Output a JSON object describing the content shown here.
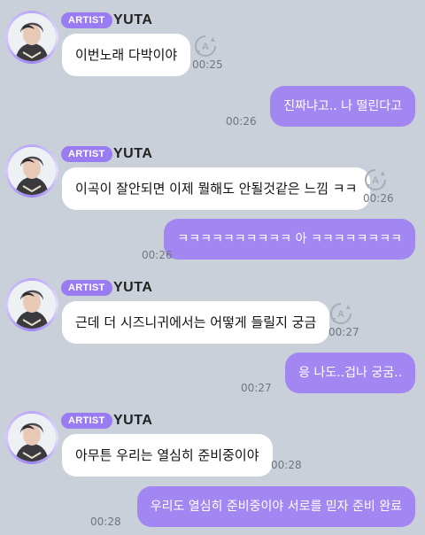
{
  "colors": {
    "background": "#c9d0da",
    "artist_badge": "#9a7cf2",
    "outgoing_bubble": "#a287f3",
    "incoming_bubble": "#ffffff",
    "timestamp": "#6f7680"
  },
  "icons": {
    "translate": "translate-icon",
    "avatar": "avatar"
  },
  "messages": [
    {
      "type": "artist",
      "badge": "ARTIST",
      "name": "YUTA",
      "text": "이번노래 다박이야",
      "time": "00:25"
    },
    {
      "type": "me",
      "text": "진짜냐고.. 나 떨린다고",
      "time": "00:26"
    },
    {
      "type": "artist",
      "badge": "ARTIST",
      "name": "YUTA",
      "text": "이곡이 잘안되면 이제 뭘해도 안될것같은 느낌 ㅋㅋ",
      "time": "00:26"
    },
    {
      "type": "me",
      "text": "ㅋㅋㅋㅋㅋㅋㅋㅋㅋㅋ 아 ㅋㅋㅋㅋㅋㅋㅋㅋ",
      "time": "00:26"
    },
    {
      "type": "artist",
      "badge": "ARTIST",
      "name": "YUTA",
      "text": "근데 더 시즈니귀에서는 어떻게 들릴지 궁금",
      "time": "00:27"
    },
    {
      "type": "me",
      "text": "응 나도..겁나 궁굼..",
      "time": "00:27"
    },
    {
      "type": "artist",
      "badge": "ARTIST",
      "name": "YUTA",
      "text": "아무튼 우리는 열심히 준비중이야",
      "time": "00:28"
    },
    {
      "type": "me",
      "text": "우리도 열심히 준비중이야 서로를 믿자 준비 완료",
      "time": "00:28"
    }
  ]
}
